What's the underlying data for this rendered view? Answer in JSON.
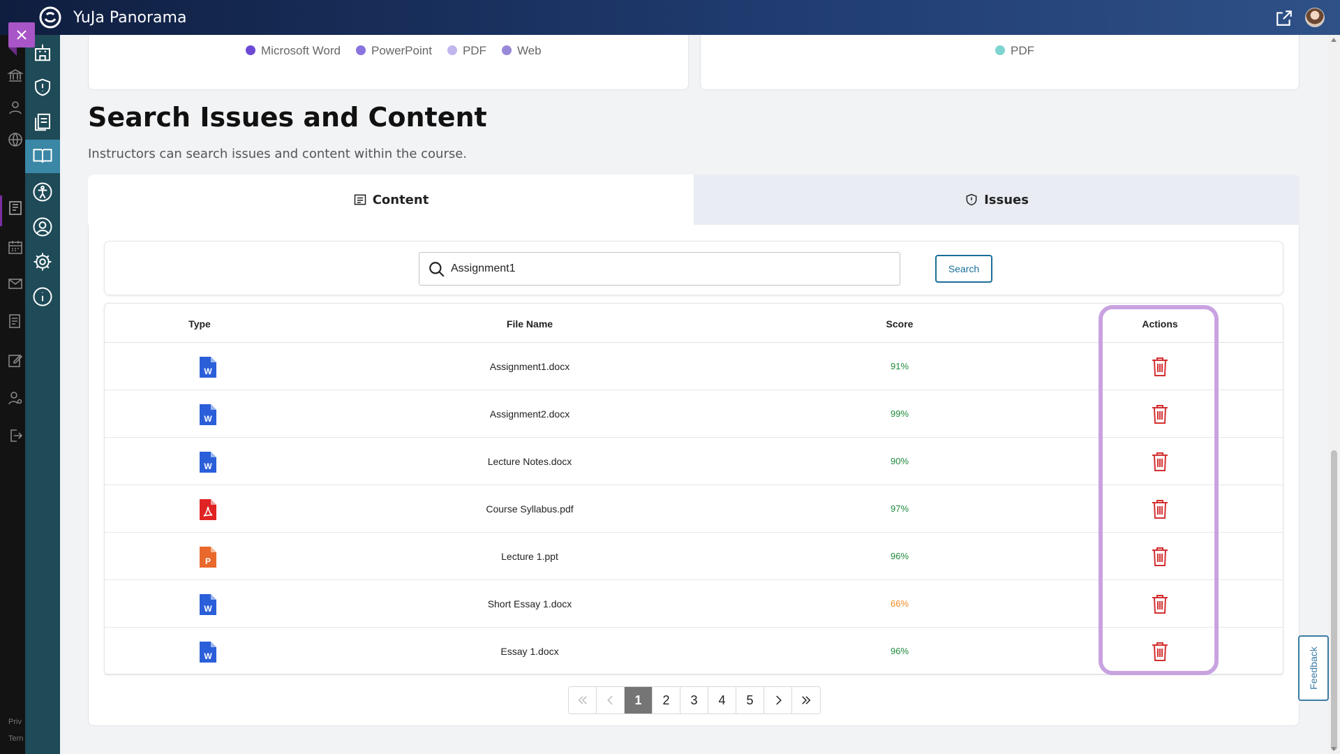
{
  "app": {
    "title": "YuJa Panorama"
  },
  "colors": {
    "accent": "#1a6e99",
    "score_good": "#1e8a3c",
    "score_warn": "#f08a24",
    "delete": "#d32f2f",
    "highlight": "#c9a2e0"
  },
  "left_footer": {
    "privacy": "Priv",
    "terms": "Tern"
  },
  "top_cards": {
    "left_legend": [
      "Microsoft Word",
      "PowerPoint",
      "PDF",
      "Web"
    ],
    "right_legend": [
      "PDF"
    ]
  },
  "section": {
    "title": "Search Issues and Content",
    "subtitle": "Instructors can search issues and content within the course."
  },
  "tabs": [
    {
      "label": "Content",
      "icon": "list-icon",
      "active": true
    },
    {
      "label": "Issues",
      "icon": "shield-icon",
      "active": false
    }
  ],
  "search": {
    "value": "Assignment1",
    "button_label": "Search"
  },
  "table": {
    "headers": {
      "type": "Type",
      "file_name": "File Name",
      "score": "Score",
      "actions": "Actions"
    },
    "rows": [
      {
        "type": "word-icon",
        "file_name": "Assignment1.docx",
        "score": "91%"
      },
      {
        "type": "word-icon",
        "file_name": "Assignment2.docx",
        "score": "99%"
      },
      {
        "type": "word-icon",
        "file_name": "Lecture Notes.docx",
        "score": "90%"
      },
      {
        "type": "pdf-icon",
        "file_name": "Course Syllabus.pdf",
        "score": "97%"
      },
      {
        "type": "powerpoint-icon",
        "file_name": "Lecture 1.ppt",
        "score": "96%"
      },
      {
        "type": "word-icon",
        "file_name": "Short Essay 1.docx",
        "score": "66%"
      },
      {
        "type": "word-icon",
        "file_name": "Essay 1.docx",
        "score": "96%"
      }
    ]
  },
  "pagination": {
    "pages": [
      "1",
      "2",
      "3",
      "4",
      "5"
    ],
    "current": "1"
  },
  "feedback": {
    "label": "Feedback"
  }
}
